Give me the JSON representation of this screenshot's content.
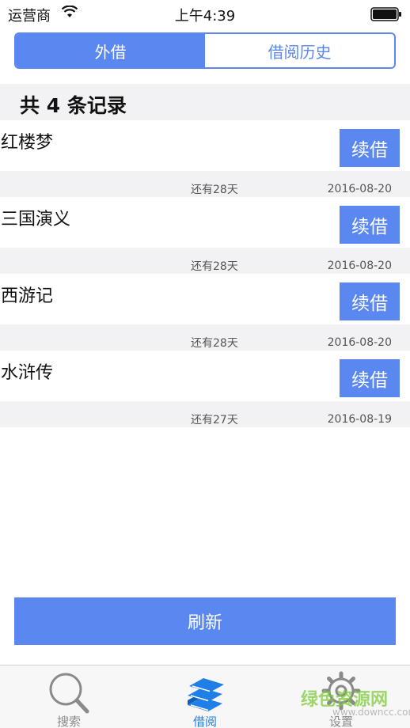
{
  "status_bar": {
    "carrier": "运营商",
    "time": "上午4:39"
  },
  "segments": {
    "outside": "外借",
    "history": "借阅历史",
    "active": "outside"
  },
  "summary": {
    "prefix": "共",
    "count": "4",
    "suffix": "条记录"
  },
  "records": [
    {
      "title": "红楼梦",
      "renew_label": "续借",
      "remaining": "还有28天",
      "due_date": "2016-08-20"
    },
    {
      "title": "三国演义",
      "renew_label": "续借",
      "remaining": "还有28天",
      "due_date": "2016-08-20"
    },
    {
      "title": "西游记",
      "renew_label": "续借",
      "remaining": "还有28天",
      "due_date": "2016-08-20"
    },
    {
      "title": "水浒传",
      "renew_label": "续借",
      "remaining": "还有27天",
      "due_date": "2016-08-19"
    }
  ],
  "refresh_label": "刷新",
  "tab_bar": {
    "items": [
      {
        "label": "搜索",
        "icon": "search-icon",
        "active": false
      },
      {
        "label": "借阅",
        "icon": "books-icon",
        "active": true
      },
      {
        "label": "设置",
        "icon": "gear-icon",
        "active": false
      }
    ]
  },
  "watermark": {
    "text": "绿色资源网",
    "sub": "www.downcc.com"
  },
  "colors": {
    "accent": "#5a88f0",
    "tab_active": "#1f7fe6",
    "strip": "#f2f2f5"
  }
}
